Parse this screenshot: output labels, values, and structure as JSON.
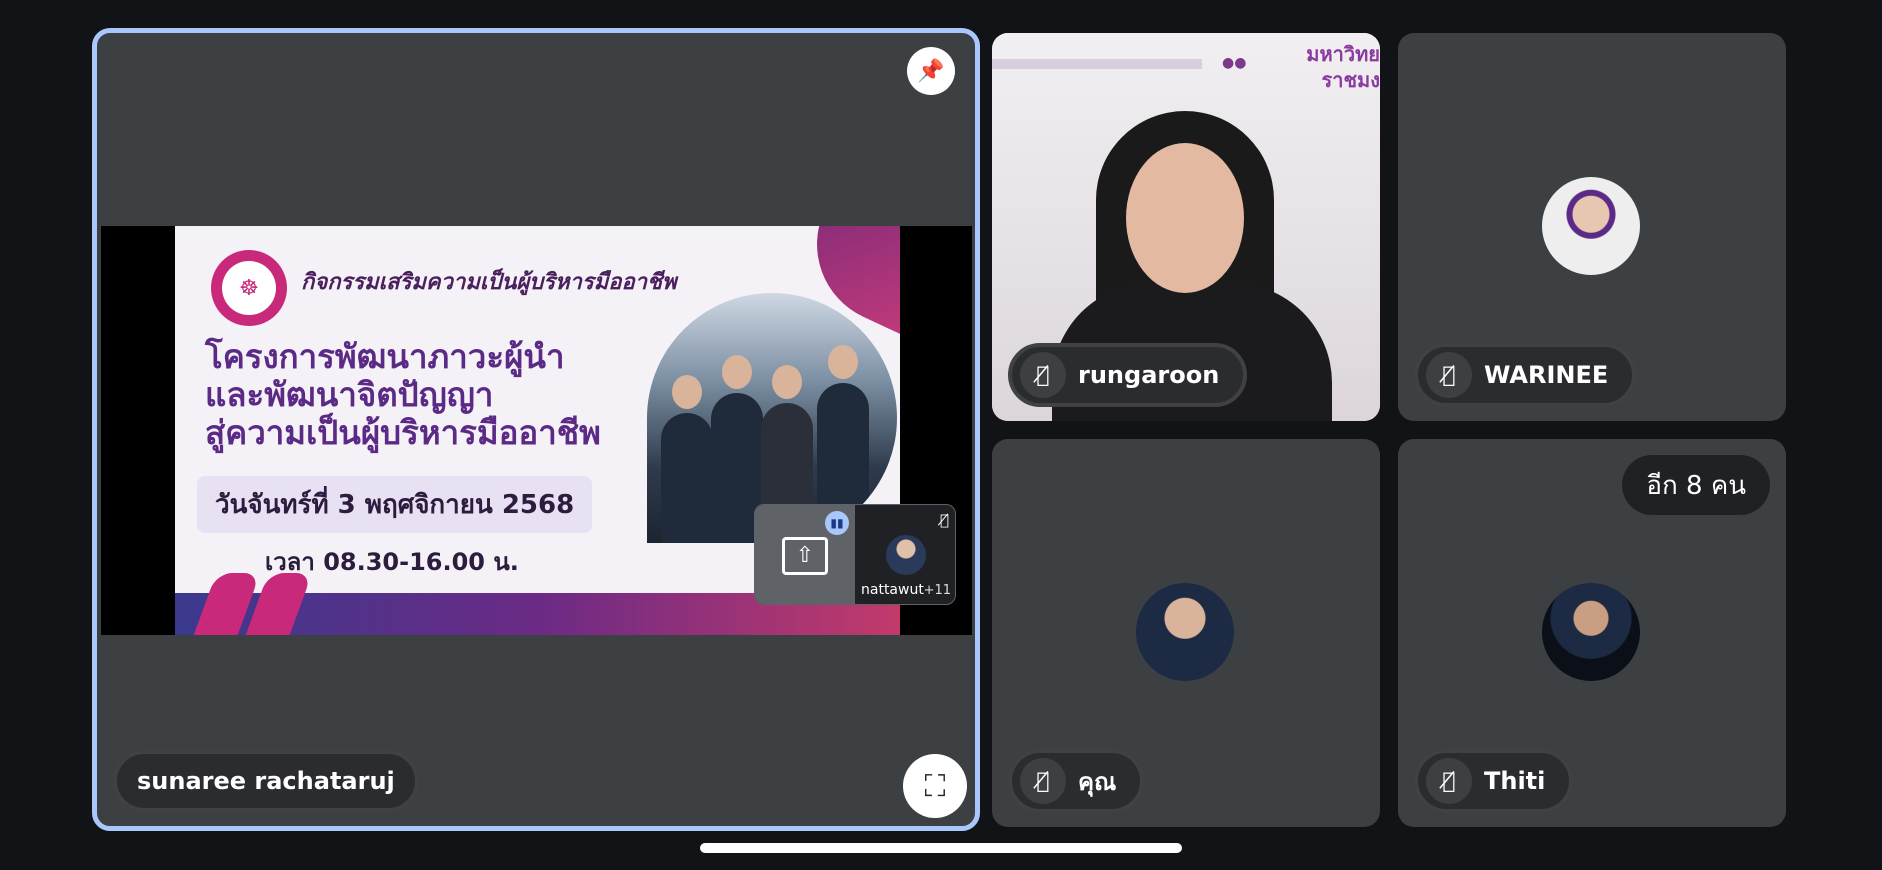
{
  "main": {
    "presenter_name": "sunaree rachataruj",
    "slide": {
      "header": "กิจกรรมเสริมความเป็นผู้บริหารมืออาชีพ",
      "title_lines": [
        "โครงการพัฒนาภาวะผู้นำ",
        "และพัฒนาจิตปัญญา",
        "สู่ความเป็นผู้บริหารมืออาชีพ"
      ],
      "date": "วันจันทร์ที่ 3 พฤศจิกายน 2568",
      "time": "เวลา 08.30-16.00 น."
    },
    "pip": {
      "name": "nattawut",
      "extra_count": "+11"
    }
  },
  "participants": [
    {
      "name": "rungaroon",
      "muted": true,
      "video": true,
      "logo_text": "มหาวิทย\nราชมง"
    },
    {
      "name": "WARINEE",
      "muted": true,
      "video": false
    },
    {
      "name": "คุณ",
      "muted": true,
      "video": false
    },
    {
      "name": "Thiti",
      "muted": true,
      "video": false
    }
  ],
  "more_participants": "อีก 8 คน",
  "icons": {
    "pin": "pin-icon",
    "fullscreen": "fullscreen-icon",
    "mic_off": "mic-off-icon",
    "screen_share": "screen-share-icon"
  },
  "colors": {
    "active_border": "#a8c7fa",
    "tile_bg": "#3c4043",
    "page_bg": "#121316"
  }
}
